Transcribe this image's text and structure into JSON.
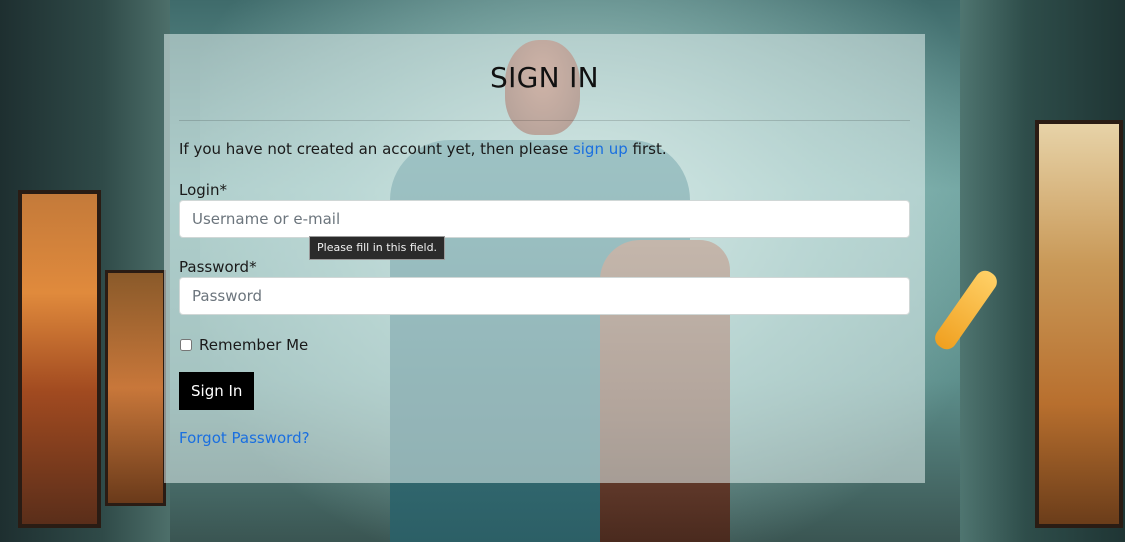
{
  "form": {
    "title": "SIGN IN",
    "intro_before": "If you have not created an account yet, then please ",
    "intro_link": "sign up",
    "intro_after": " first.",
    "login_label": "Login*",
    "login_placeholder": "Username or e-mail",
    "login_value": "",
    "tooltip": "Please fill in this field.",
    "password_label": "Password*",
    "password_placeholder": "Password",
    "password_value": "",
    "remember_label": "Remember Me",
    "remember_checked": false,
    "submit_label": "Sign In",
    "forgot_label": "Forgot Password?"
  },
  "colors": {
    "link": "#1a6fe0",
    "button_bg": "#000000",
    "button_text": "#ffffff"
  }
}
